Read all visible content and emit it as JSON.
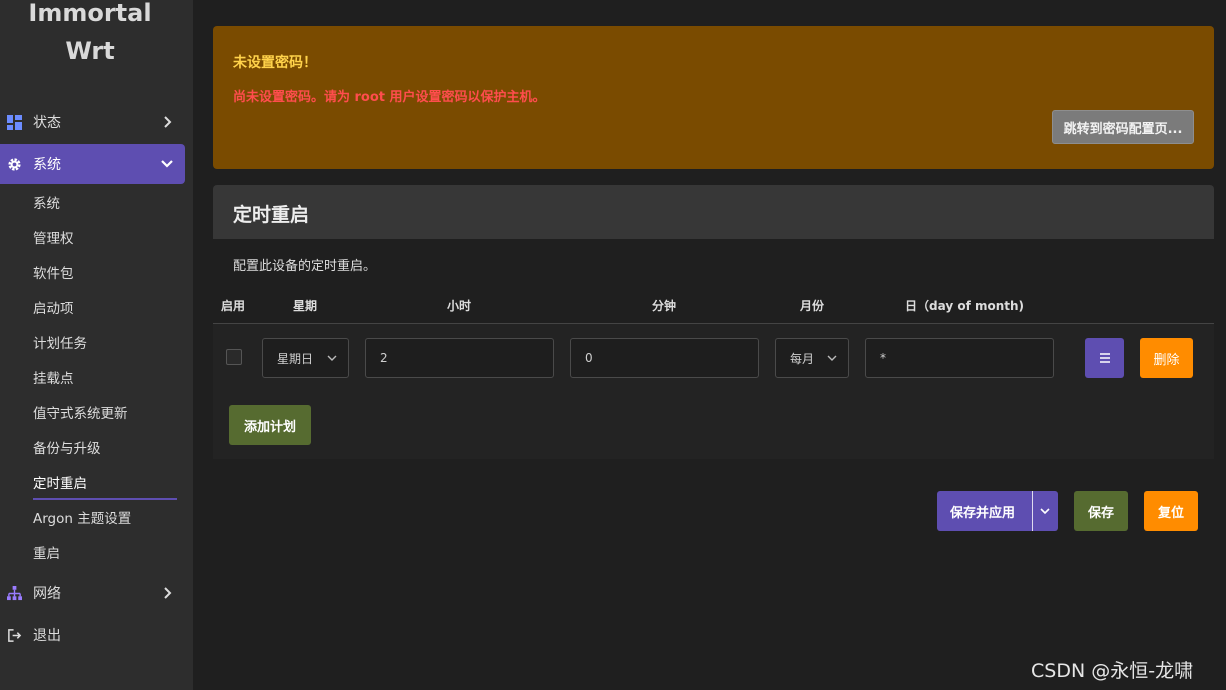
{
  "brand": {
    "line1": "Immortal",
    "line2": "Wrt"
  },
  "sidebar": {
    "items": [
      {
        "label": "状态",
        "icon": "dashboard-icon"
      },
      {
        "label": "系统",
        "icon": "gear-icon"
      },
      {
        "label": "网络",
        "icon": "network-icon"
      },
      {
        "label": "退出",
        "icon": "logout-icon"
      }
    ],
    "sub_items": [
      "系统",
      "管理权",
      "软件包",
      "启动项",
      "计划任务",
      "挂载点",
      "值守式系统更新",
      "备份与升级",
      "定时重启",
      "Argon 主题设置",
      "重启"
    ]
  },
  "alert": {
    "title": "未设置密码！",
    "message": "尚未设置密码。请为 root 用户设置密码以保护主机。",
    "button": "跳转到密码配置页..."
  },
  "section": {
    "title": "定时重启",
    "description": "配置此设备的定时重启。"
  },
  "table": {
    "headers": [
      "启用",
      "星期",
      "小时",
      "分钟",
      "月份",
      "日（day of month)"
    ],
    "row": {
      "weekday": "星期日",
      "hour": "2",
      "minute": "0",
      "month": "每月",
      "day": "*",
      "delete_label": "删除"
    },
    "add_label": "添加计划"
  },
  "footer": {
    "save_apply": "保存并应用",
    "save": "保存",
    "reset": "复位"
  },
  "watermark": "CSDN @永恒-龙啸",
  "colors": {
    "accent": "#5e4eb1",
    "warning_bg": "#7a4b00",
    "success": "#566b30",
    "orange": "#ff8c00",
    "alert_title": "#ffd24a",
    "alert_text": "#ff4d4d"
  }
}
